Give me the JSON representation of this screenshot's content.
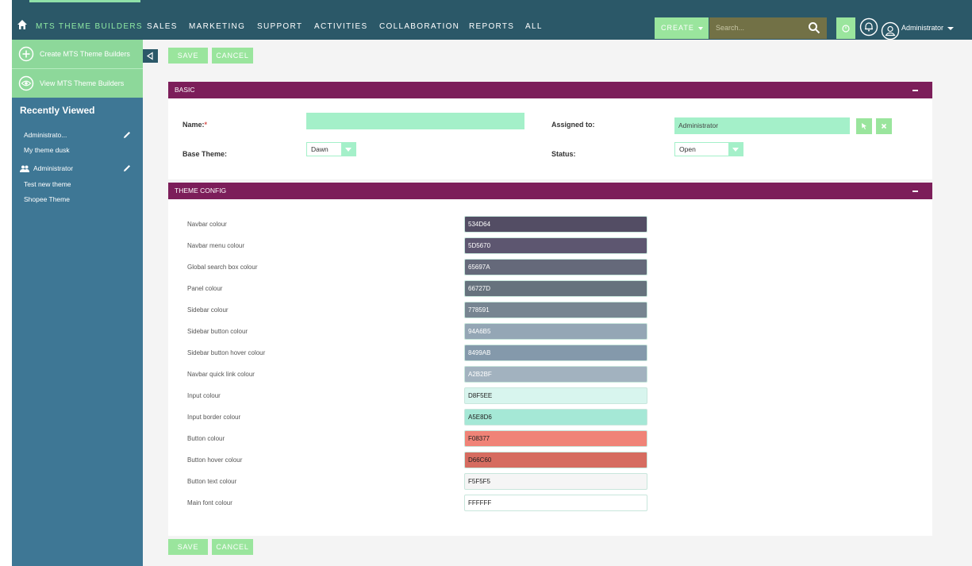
{
  "nav": {
    "brand": "MTS THEME BUILDERS",
    "items": [
      "SALES",
      "MARKETING",
      "SUPPORT",
      "ACTIVITIES",
      "COLLABORATION",
      "REPORTS",
      "ALL"
    ],
    "create_label": "CREATE",
    "search_placeholder": "Search...",
    "user": "Administrator"
  },
  "sidebar": {
    "actions": [
      {
        "label": "Create MTS Theme Builders",
        "icon": "plus-circle-icon"
      },
      {
        "label": "View MTS Theme Builders",
        "icon": "eye-icon"
      }
    ],
    "recent_title": "Recently Viewed",
    "recent": [
      {
        "label": "Administrato...",
        "editable": true
      },
      {
        "label": "My theme dusk",
        "editable": false
      },
      {
        "label": "Administrator",
        "editable": true,
        "icon": "people-icon"
      },
      {
        "label": "Test new theme",
        "editable": false
      },
      {
        "label": "Shopee Theme",
        "editable": false
      }
    ]
  },
  "buttons": {
    "save": "SAVE",
    "cancel": "CANCEL"
  },
  "basic": {
    "title": "BASIC",
    "name_label": "Name:",
    "required_mark": "*",
    "name_value": "",
    "assigned_label": "Assigned to:",
    "assigned_value": "Administrator",
    "base_theme_label": "Base Theme:",
    "base_theme_value": "Dawn",
    "status_label": "Status:",
    "status_value": "Open"
  },
  "theme_config": {
    "title": "THEME CONFIG",
    "rows": [
      {
        "label": "Navbar colour",
        "value": "534D64",
        "color": "#534D64",
        "text_color": "#ffffff"
      },
      {
        "label": "Navbar menu colour",
        "value": "5D5670",
        "color": "#5D5670",
        "text_color": "#ffffff"
      },
      {
        "label": "Global search box colour",
        "value": "65697A",
        "color": "#65697A",
        "text_color": "#ffffff"
      },
      {
        "label": "Panel colour",
        "value": "66727D",
        "color": "#66727D",
        "text_color": "#ffffff"
      },
      {
        "label": "Sidebar colour",
        "value": "778591",
        "color": "#778591",
        "text_color": "#ffffff"
      },
      {
        "label": "Sidebar button colour",
        "value": "94A6B5",
        "color": "#94A6B5",
        "text_color": "#ffffff"
      },
      {
        "label": "Sidebar button hover colour",
        "value": "8499AB",
        "color": "#8499AB",
        "text_color": "#ffffff"
      },
      {
        "label": "Navbar quick link colour",
        "value": "A2B2BF",
        "color": "#A2B2BF",
        "text_color": "#ffffff"
      },
      {
        "label": "Input colour",
        "value": "D8F5EE",
        "color": "#D8F5EE",
        "text_color": "#222222"
      },
      {
        "label": "Input border colour",
        "value": "A5E8D6",
        "color": "#A5E8D6",
        "text_color": "#222222"
      },
      {
        "label": "Button colour",
        "value": "F08377",
        "color": "#F08377",
        "text_color": "#222222"
      },
      {
        "label": "Button hover colour",
        "value": "D66C60",
        "color": "#D66C60",
        "text_color": "#222222"
      },
      {
        "label": "Button text colour",
        "value": "F5F5F5",
        "color": "#F5F5F5",
        "text_color": "#222222"
      },
      {
        "label": "Main font colour",
        "value": "FFFFFF",
        "color": "#FFFFFF",
        "text_color": "#222222"
      }
    ]
  }
}
